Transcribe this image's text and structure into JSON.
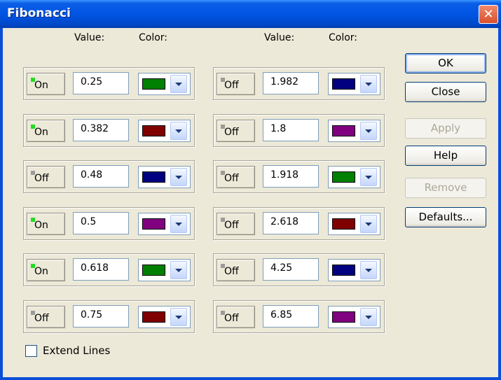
{
  "window": {
    "title": "Fibonacci",
    "close_glyph": "✕"
  },
  "headers": {
    "left_value": "Value:",
    "left_color": "Color:",
    "right_value": "Value:",
    "right_color": "Color:"
  },
  "left_rows": [
    {
      "state": "On",
      "on": true,
      "value": "0.25",
      "color": "#008000"
    },
    {
      "state": "On",
      "on": true,
      "value": "0.382",
      "color": "#800000"
    },
    {
      "state": "Off",
      "on": false,
      "value": "0.48",
      "color": "#000080"
    },
    {
      "state": "On",
      "on": true,
      "value": "0.5",
      "color": "#800080"
    },
    {
      "state": "On",
      "on": true,
      "value": "0.618",
      "color": "#008000"
    },
    {
      "state": "Off",
      "on": false,
      "value": "0.75",
      "color": "#800000"
    }
  ],
  "right_rows": [
    {
      "state": "Off",
      "on": false,
      "value": "1.982",
      "color": "#000080"
    },
    {
      "state": "Off",
      "on": false,
      "value": "1.8",
      "color": "#800080"
    },
    {
      "state": "Off",
      "on": false,
      "value": "1.918",
      "color": "#008000"
    },
    {
      "state": "Off",
      "on": false,
      "value": "2.618",
      "color": "#800000"
    },
    {
      "state": "Off",
      "on": false,
      "value": "4.25",
      "color": "#000080"
    },
    {
      "state": "Off",
      "on": false,
      "value": "6.85",
      "color": "#800080"
    }
  ],
  "buttons": {
    "ok": "OK",
    "close": "Close",
    "apply": "Apply",
    "help": "Help",
    "remove": "Remove",
    "defaults": "Defaults..."
  },
  "extend_lines": {
    "label": "Extend Lines",
    "checked": false
  }
}
